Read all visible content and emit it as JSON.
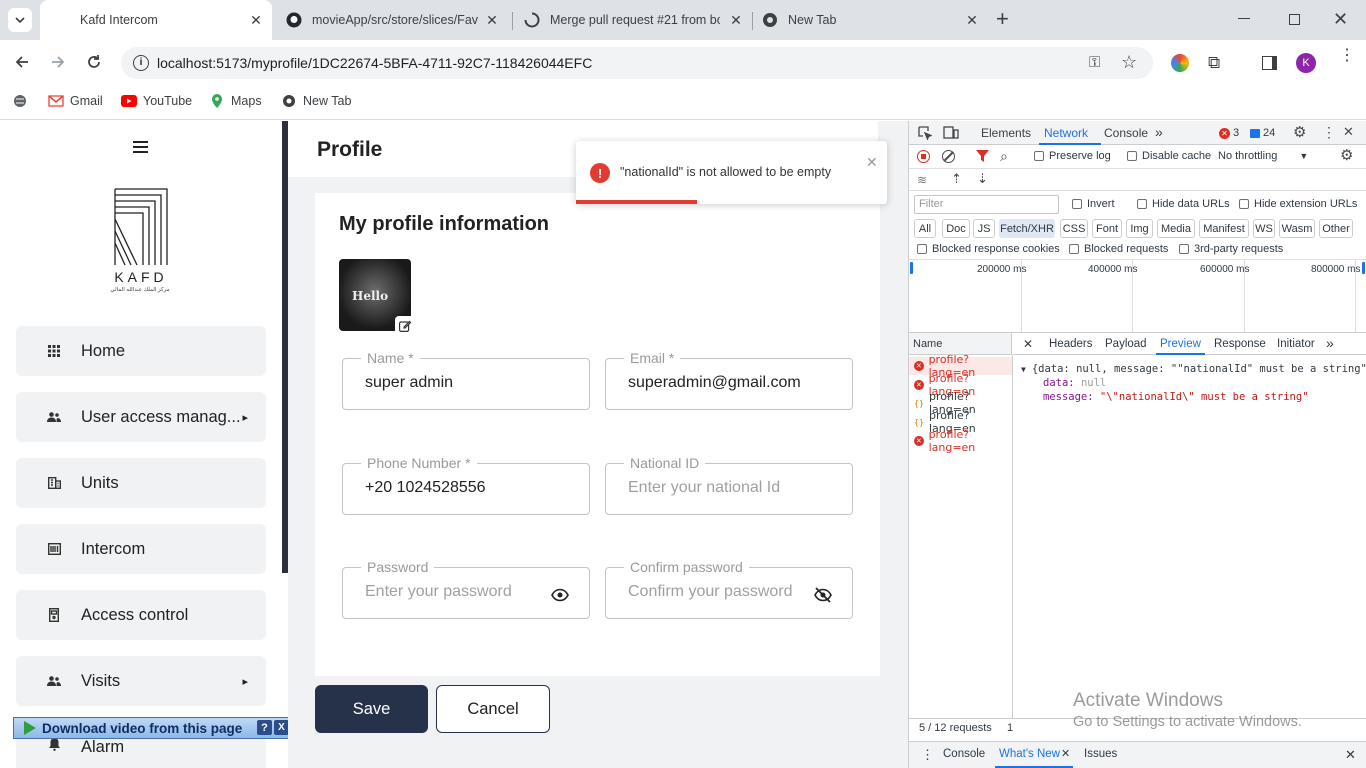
{
  "browser": {
    "tabs": [
      {
        "title": "Kafd Intercom"
      },
      {
        "title": "movieApp/src/store/slices/Favo"
      },
      {
        "title": "Merge pull request #21 from bo"
      },
      {
        "title": "New Tab"
      }
    ],
    "url": "localhost:5173/myprofile/1DC22674-5BFA-4711-92C7-118426044EFC",
    "profile_initial": "K",
    "bookmarks": [
      {
        "label": "Gmail"
      },
      {
        "label": "YouTube"
      },
      {
        "label": "Maps"
      },
      {
        "label": "New Tab"
      }
    ]
  },
  "sidebar": {
    "logo_text": "KAFD",
    "logo_subtext": "مركز الملك عبدالله المالي",
    "items": [
      {
        "label": "Home",
        "icon": "grid-icon"
      },
      {
        "label": "User access manag...",
        "icon": "users-icon"
      },
      {
        "label": "Units",
        "icon": "building-icon"
      },
      {
        "label": "Intercom",
        "icon": "intercom-icon"
      },
      {
        "label": "Access control",
        "icon": "door-icon"
      },
      {
        "label": "Visits",
        "icon": "visitors-icon"
      },
      {
        "label": "Alarm",
        "icon": "bell-icon"
      }
    ]
  },
  "page": {
    "title": "Profile",
    "section_title": "My profile information",
    "avatar_text": "Hello",
    "fields": {
      "name": {
        "label": "Name",
        "required": "*",
        "value": "super admin"
      },
      "email": {
        "label": "Email",
        "required": "*",
        "value": "superadmin@gmail.com"
      },
      "phone": {
        "label": "Phone Number",
        "required": "*",
        "value": "+20 1024528556"
      },
      "national_id": {
        "label": "National ID",
        "placeholder": "Enter your national Id"
      },
      "password": {
        "label": "Password",
        "placeholder": "Enter your password"
      },
      "confirm": {
        "label": "Confirm password",
        "placeholder": "Confirm your password"
      }
    },
    "save_label": "Save",
    "cancel_label": "Cancel"
  },
  "toast": {
    "message": "\"nationalId\" is not allowed to be empty",
    "progress": 0.39
  },
  "extension_bar": {
    "label": "Download video from this page",
    "help": "?",
    "close": "X"
  },
  "devtools": {
    "tabs": [
      "Elements",
      "Network",
      "Console"
    ],
    "errors": "3",
    "messages": "24",
    "preserve_log": "Preserve log",
    "disable_cache": "Disable cache",
    "throttling": "No throttling",
    "filter_placeholder": "Filter",
    "invert": "Invert",
    "hide_data_urls": "Hide data URLs",
    "hide_ext_urls": "Hide extension URLs",
    "type_chips": [
      "All",
      "Doc",
      "JS",
      "Fetch/XHR",
      "CSS",
      "Font",
      "Img",
      "Media",
      "Manifest",
      "WS",
      "Wasm",
      "Other"
    ],
    "blocked_cookies": "Blocked response cookies",
    "blocked_requests": "Blocked requests",
    "third_party": "3rd-party requests",
    "timeline_ticks": [
      "200000 ms",
      "400000 ms",
      "600000 ms",
      "800000 ms"
    ],
    "name_header": "Name",
    "detail_tabs": [
      "Headers",
      "Payload",
      "Preview",
      "Response",
      "Initiator"
    ],
    "requests": [
      {
        "name": "profile?lang=en",
        "status": "error"
      },
      {
        "name": "profile?lang=en",
        "status": "error"
      },
      {
        "name": "profile?lang=en",
        "status": "fetch"
      },
      {
        "name": "profile?lang=en",
        "status": "fetch"
      },
      {
        "name": "profile?lang=en",
        "status": "error"
      }
    ],
    "preview_summary": "{data: null, message: \"\"nationalId\" must be a string\"}",
    "preview_data_key": "data:",
    "preview_data_val": "null",
    "preview_msg_key": "message:",
    "preview_msg_val": "\"\\\"nationalId\\\" must be a string\"",
    "request_count": "5 / 12 requests",
    "request_count_tail": "1",
    "drawer_tabs": [
      "Console",
      "What's New",
      "Issues"
    ]
  },
  "watermark": {
    "line1": "Activate Windows",
    "line2": "Go to Settings to activate Windows."
  },
  "colors": {
    "sidebar_dark": "#2b303a",
    "save_button": "#26314a",
    "error_red": "#e03c31",
    "devtools_blue": "#1a73e8"
  }
}
